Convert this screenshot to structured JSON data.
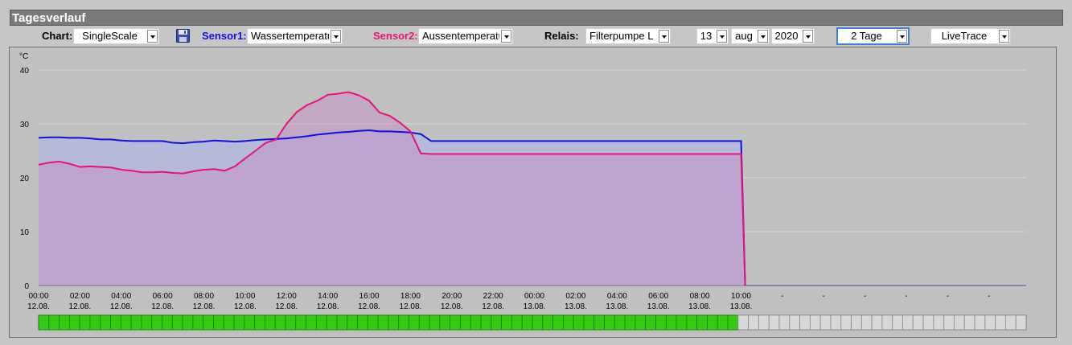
{
  "header": {
    "title": "Tagesverlauf"
  },
  "controls": {
    "chart_label": "Chart:",
    "chart_value": "SingleScale",
    "sensor1_label": "Sensor1:",
    "sensor1_value": "Wassertemperatu",
    "sensor2_label": "Sensor2:",
    "sensor2_value": "Aussentemperatu",
    "relais_label": "Relais:",
    "relais_value": "Filterpumpe L",
    "day": "13",
    "month": "aug",
    "year": "2020",
    "range": "2 Tage",
    "mode": "LiveTrace"
  },
  "colors": {
    "sensor1": "#1010e0",
    "sensor2": "#e8127a"
  },
  "chart_data": {
    "type": "area",
    "ylabel": "°C",
    "ylim": [
      0,
      40
    ],
    "yticks": [
      0,
      10,
      20,
      30,
      40
    ],
    "xtick_labels": [
      [
        "00:00",
        "12.08."
      ],
      [
        "02:00",
        "12.08."
      ],
      [
        "04:00",
        "12.08."
      ],
      [
        "06:00",
        "12.08."
      ],
      [
        "08:00",
        "12.08."
      ],
      [
        "10:00",
        "12.08."
      ],
      [
        "12:00",
        "12.08."
      ],
      [
        "14:00",
        "12.08."
      ],
      [
        "16:00",
        "12.08."
      ],
      [
        "18:00",
        "12.08."
      ],
      [
        "20:00",
        "12.08."
      ],
      [
        "22:00",
        "12.08."
      ],
      [
        "00:00",
        "13.08."
      ],
      [
        "02:00",
        "13.08."
      ],
      [
        "04:00",
        "13.08."
      ],
      [
        "06:00",
        "13.08."
      ],
      [
        "08:00",
        "13.08."
      ],
      [
        "10:00",
        "13.08."
      ],
      [
        "-",
        ""
      ],
      [
        "-",
        ""
      ],
      [
        "-",
        ""
      ],
      [
        "-",
        ""
      ],
      [
        "-",
        ""
      ],
      [
        "-",
        ""
      ]
    ],
    "x_hours": [
      0,
      0.5,
      1,
      1.5,
      2,
      2.5,
      3,
      3.5,
      4,
      4.5,
      5,
      5.5,
      6,
      6.5,
      7,
      7.5,
      8,
      8.5,
      9,
      9.5,
      10,
      10.5,
      11,
      11.5,
      12,
      12.5,
      13,
      13.5,
      14,
      14.5,
      15,
      15.5,
      16,
      16.5,
      17,
      17.5,
      18,
      18.5,
      19,
      19.5,
      20,
      34,
      34.2
    ],
    "series": [
      {
        "color_key": "sensor1",
        "values": [
          27.4,
          27.5,
          27.5,
          27.4,
          27.4,
          27.3,
          27.1,
          27.1,
          26.9,
          26.8,
          26.8,
          26.8,
          26.8,
          26.5,
          26.4,
          26.6,
          26.7,
          26.9,
          26.8,
          26.7,
          26.8,
          27.0,
          27.1,
          27.2,
          27.3,
          27.5,
          27.7,
          28.0,
          28.2,
          28.4,
          28.5,
          28.7,
          28.8,
          28.6,
          28.6,
          28.5,
          28.4,
          28.1,
          26.8,
          26.8,
          26.8,
          26.8,
          0
        ]
      },
      {
        "color_key": "sensor2",
        "values": [
          22.4,
          22.8,
          23.0,
          22.6,
          22.0,
          22.1,
          22.0,
          21.9,
          21.5,
          21.3,
          21.0,
          21.0,
          21.1,
          20.9,
          20.8,
          21.2,
          21.5,
          21.6,
          21.3,
          22.1,
          23.6,
          25.0,
          26.5,
          27.1,
          30.0,
          32.2,
          33.5,
          34.3,
          35.4,
          35.6,
          35.9,
          35.3,
          34.3,
          32.1,
          31.5,
          30.2,
          28.6,
          24.5,
          24.4,
          24.4,
          24.4,
          24.4,
          0
        ]
      }
    ],
    "relay_status": [
      1,
      1,
      1,
      1,
      1,
      1,
      1,
      1,
      1,
      1,
      1,
      1,
      1,
      1,
      1,
      1,
      1,
      1,
      1,
      1,
      1,
      1,
      1,
      1,
      1,
      1,
      1,
      1,
      1,
      1,
      1,
      1,
      1,
      1,
      1,
      1,
      1,
      1,
      1,
      1,
      1,
      1,
      1,
      1,
      1,
      1,
      1,
      1,
      1,
      1,
      1,
      1,
      1,
      1,
      1,
      1,
      1,
      1,
      1,
      1,
      1,
      1,
      1,
      1,
      1,
      1,
      1,
      1,
      0,
      0,
      0,
      0,
      0,
      0,
      0,
      0,
      0,
      0,
      0,
      0,
      0,
      0,
      0,
      0,
      0,
      0,
      0,
      0,
      0,
      0,
      0,
      0,
      0,
      0,
      0,
      0
    ]
  }
}
